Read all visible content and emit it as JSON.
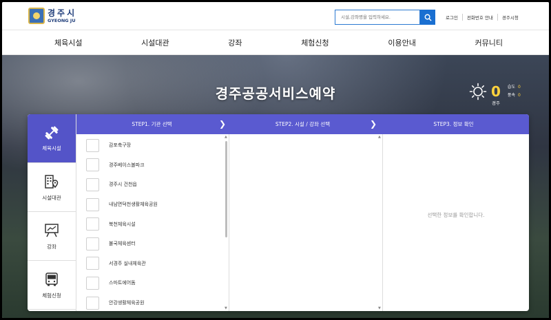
{
  "brand": {
    "kor": "경주시",
    "eng": "GYEONG JU"
  },
  "search": {
    "placeholder": "시설,강좌명을 입력하세요."
  },
  "util_links": [
    "로그인",
    "전화번호 안내",
    "경주시청"
  ],
  "nav": [
    "체육시설",
    "시설대관",
    "강좌",
    "체험신청",
    "이용안내",
    "커뮤니티"
  ],
  "hero": {
    "title": "경주공공서비스예약"
  },
  "weather": {
    "icon": "sun-icon",
    "temp": "0",
    "city": "경주",
    "humidity_label": "습도",
    "humidity": "0",
    "wind_label": "풍속",
    "wind": "0"
  },
  "side_menu": [
    {
      "label": "체육시설",
      "icon": "dumbbell-icon",
      "active": true
    },
    {
      "label": "시설대관",
      "icon": "building-pin-icon",
      "active": false
    },
    {
      "label": "강좌",
      "icon": "lecture-board-icon",
      "active": false
    },
    {
      "label": "체험신청",
      "icon": "bus-icon",
      "active": false
    }
  ],
  "steps": [
    "STEP1. 기관 선택",
    "STEP2. 시설 / 강좌 선택",
    "STEP3. 정보 확인"
  ],
  "facilities": [
    "감포축구장",
    "경주베이스볼파크",
    "경주시 건천읍",
    "내남면덕천생활체육공원",
    "북천체육시설",
    "불국체육센터",
    "서경주 실내체육관",
    "스마트에어돔",
    "안강생활체육공원"
  ],
  "info_placeholder": "선택한 정보를 확인합니다.",
  "colors": {
    "accent": "#5a5ad0",
    "active": "#5454c8",
    "search": "#1a6fd1",
    "temp": "#ffd23d"
  }
}
